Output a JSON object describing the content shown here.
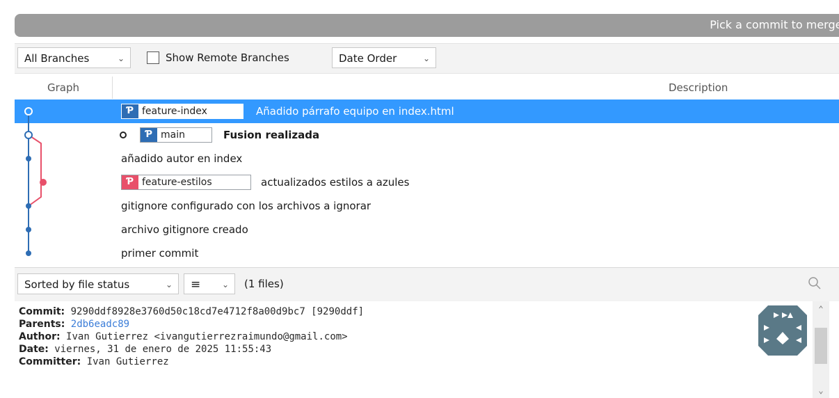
{
  "banner": {
    "text": "Pick a commit to merge i"
  },
  "toolbar": {
    "branch_filter": "All Branches",
    "show_remote_label": "Show Remote Branches",
    "show_remote_checked": false,
    "order": "Date Order"
  },
  "columns": {
    "graph": "Graph",
    "description": "Description"
  },
  "commits": [
    {
      "message": "Añadido párrafo equipo en index.html",
      "branch": "feature-index",
      "selected": true
    },
    {
      "message": "Fusion realizada",
      "branch": "main",
      "bold": true,
      "head": true
    },
    {
      "message": "añadido autor en index"
    },
    {
      "message": "actualizados estilos a azules",
      "branch": "feature-estilos"
    },
    {
      "message": "gitignore configurado con los archivos a ignorar"
    },
    {
      "message": "archivo gitignore creado"
    },
    {
      "message": "primer commit"
    }
  ],
  "files_bar": {
    "sort": "Sorted by file status",
    "view_icon": "list-icon",
    "count": "(1 files)"
  },
  "details": {
    "commit_label": "Commit:",
    "commit_value": "9290ddf8928e3760d50c18cd7e4712f8a00d9bc7 [9290ddf]",
    "parents_label": "Parents:",
    "parents_value": "2db6eadc89",
    "author_label": "Author:",
    "author_value": "Ivan Gutierrez <ivangutierrezraimundo@gmail.com>",
    "date_label": "Date:",
    "date_value": "viernes, 31 de enero de 2025 11:55:43",
    "committer_label": "Committer:",
    "committer_value": "Ivan Gutierrez"
  },
  "colors": {
    "selection": "#3399ff",
    "main_branch": "#2e6db4",
    "feature_estilos": "#e8506a",
    "banner": "#9c9c9c"
  }
}
